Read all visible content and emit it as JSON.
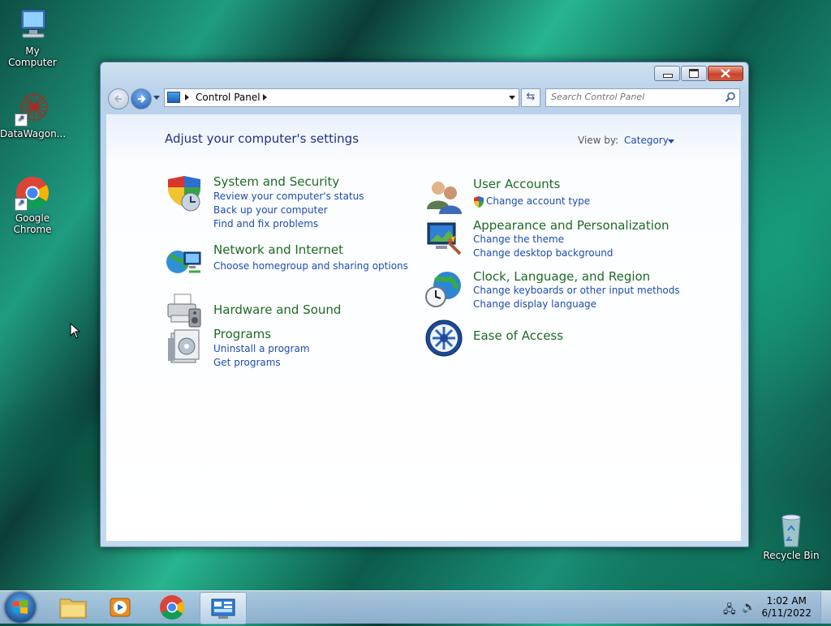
{
  "desktop": {
    "icons": [
      {
        "label": "My Computer"
      },
      {
        "label": "DataWagon..."
      },
      {
        "label": "Google\nChrome",
        "line1": "Google",
        "line2": "Chrome"
      },
      {
        "label": "Recycle Bin"
      }
    ]
  },
  "window": {
    "address": {
      "crumb": "Control Panel"
    },
    "search": {
      "placeholder": "Search Control Panel"
    },
    "heading": "Adjust your computer's settings",
    "view_by": {
      "label": "View by:",
      "value": "Category"
    },
    "categories": [
      {
        "title": "System and Security",
        "links": [
          "Review your computer's status",
          "Back up your computer",
          "Find and fix problems"
        ],
        "icon": "shield-icon"
      },
      {
        "title": "Network and Internet",
        "links": [
          "Choose homegroup and sharing options"
        ],
        "icon": "network-icon"
      },
      {
        "title": "Hardware and Sound",
        "links": [],
        "icon": "printer-icon"
      },
      {
        "title": "Programs",
        "links": [
          "Uninstall a program",
          "Get programs"
        ],
        "icon": "programs-icon"
      },
      {
        "title": "User Accounts",
        "links": [
          "Change account type"
        ],
        "icon": "users-icon"
      },
      {
        "title": "Appearance and Personalization",
        "links": [
          "Change the theme",
          "Change desktop background"
        ],
        "icon": "appearance-icon"
      },
      {
        "title": "Clock, Language, and Region",
        "links": [
          "Change keyboards or other input methods",
          "Change display language"
        ],
        "icon": "clock-globe-icon"
      },
      {
        "title": "Ease of Access",
        "links": [],
        "icon": "ease-of-access-icon"
      }
    ]
  },
  "taskbar": {
    "time": "1:02 AM",
    "date": "6/11/2022"
  },
  "colors": {
    "link": "#1e4cb0",
    "category_title": "#1e6a24",
    "heading": "#1e3287"
  }
}
